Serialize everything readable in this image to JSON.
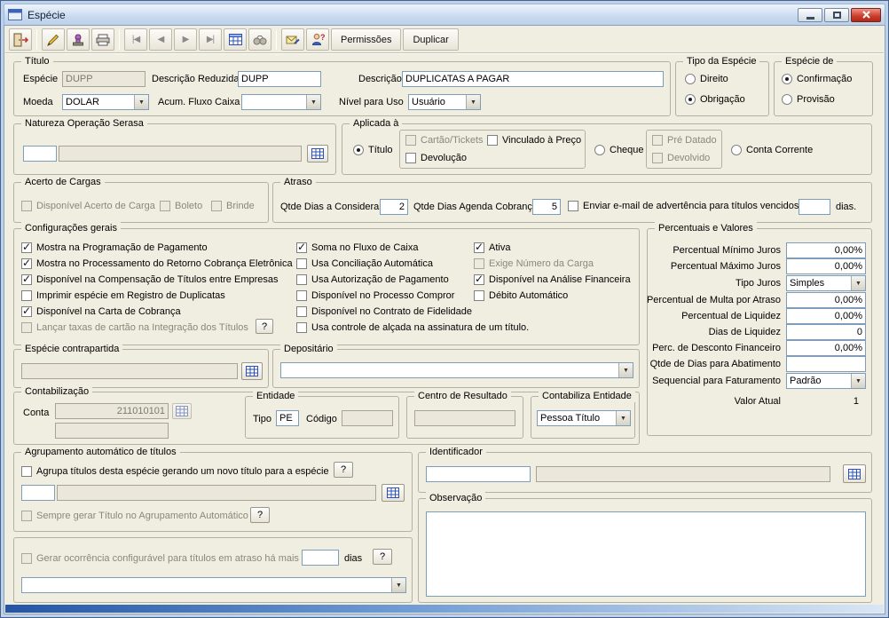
{
  "window": {
    "title": "Espécie"
  },
  "toolbar": {
    "nav_first": "|◀",
    "nav_prev": "◀",
    "nav_next": "▶",
    "nav_last": "▶|",
    "permissoes_label": "Permissões",
    "duplicar_label": "Duplicar"
  },
  "misc": {
    "help_label": "?"
  },
  "titulo": {
    "legend": "Título",
    "especie_label": "Espécie",
    "especie_value": "DUPP",
    "descricao_reduzida_label": "Descrição Reduzida",
    "descricao_reduzida_value": "DUPP",
    "descricao_label": "Descrição",
    "descricao_value": "DUPLICATAS A PAGAR",
    "moeda_label": "Moeda",
    "moeda_value": "DOLAR",
    "acum_fluxo_label": "Acum. Fluxo Caixa",
    "acum_fluxo_value": "",
    "nivel_label": "Nível para Uso",
    "nivel_value": "Usuário"
  },
  "tipo_especie": {
    "legend": "Tipo da Espécie",
    "options": [
      {
        "label": "Direito",
        "selected": false
      },
      {
        "label": "Obrigação",
        "selected": true
      }
    ]
  },
  "especie_de": {
    "legend": "Espécie de",
    "options": [
      {
        "label": "Confirmação",
        "selected": true
      },
      {
        "label": "Provisão",
        "selected": false
      }
    ]
  },
  "natureza": {
    "legend": "Natureza Operação Serasa",
    "code_value": "",
    "desc_value": ""
  },
  "aplicada": {
    "legend": "Aplicada à",
    "titulo": {
      "label": "Título",
      "selected": true
    },
    "cartao": {
      "label": "Cartão/Tickets",
      "checked": false,
      "disabled": true
    },
    "vinculado": {
      "label": "Vinculado à Preço",
      "checked": false,
      "disabled": false
    },
    "devolucao": {
      "label": "Devolução",
      "checked": false,
      "disabled": false
    },
    "cheque": {
      "label": "Cheque",
      "selected": false
    },
    "pre_datado": {
      "label": "Pré Datado",
      "checked": false,
      "disabled": true
    },
    "devolvido": {
      "label": "Devolvido",
      "checked": false,
      "disabled": true
    },
    "conta_corrente": {
      "label": "Conta Corrente",
      "selected": false
    }
  },
  "acerto": {
    "legend": "Acerto de Cargas",
    "items": [
      {
        "label": "Disponível Acerto de Carga",
        "checked": false,
        "disabled": true
      },
      {
        "label": "Boleto",
        "checked": false,
        "disabled": true
      },
      {
        "label": "Brinde",
        "checked": false,
        "disabled": true
      }
    ]
  },
  "atraso": {
    "legend": "Atraso",
    "qtde_considerar_label": "Qtde Dias a Considerar",
    "qtde_considerar_value": "2",
    "qtde_agenda_label": "Qtde Dias Agenda Cobrança",
    "qtde_agenda_value": "5",
    "email_checkbox": {
      "label": "Enviar e-mail de advertência para títulos vencidos à",
      "checked": false,
      "disabled": false
    },
    "email_dias_value": "",
    "dias_suffix": "dias."
  },
  "config": {
    "legend": "Configurações gerais",
    "col1": [
      {
        "label": "Mostra na Programação de Pagamento",
        "checked": true,
        "disabled": false
      },
      {
        "label": "Mostra no Processamento do Retorno Cobrança Eletrônica",
        "checked": true,
        "disabled": false
      },
      {
        "label": "Disponível na Compensação de Títulos entre Empresas",
        "checked": true,
        "disabled": false
      },
      {
        "label": "Imprimir espécie em Registro de Duplicatas",
        "checked": false,
        "disabled": false
      },
      {
        "label": "Disponível na Carta de Cobrança",
        "checked": true,
        "disabled": false
      },
      {
        "label": "Lançar taxas de cartão na Integração dos Títulos",
        "checked": false,
        "disabled": true
      }
    ],
    "col2": [
      {
        "label": "Soma no Fluxo de Caixa",
        "checked": true,
        "disabled": false
      },
      {
        "label": "Usa Conciliação Automática",
        "checked": false,
        "disabled": false
      },
      {
        "label": "Usa Autorização de Pagamento",
        "checked": false,
        "disabled": false
      },
      {
        "label": "Disponível no Processo Compror",
        "checked": false,
        "disabled": false
      },
      {
        "label": "Disponível no Contrato de Fidelidade",
        "checked": false,
        "disabled": false
      },
      {
        "label": "Usa controle de alçada na assinatura de um título.",
        "checked": false,
        "disabled": false
      }
    ],
    "col3": [
      {
        "label": "Ativa",
        "checked": true,
        "disabled": false
      },
      {
        "label": "Exige Número da Carga",
        "checked": false,
        "disabled": true
      },
      {
        "label": "Disponível na Análise Financeira",
        "checked": true,
        "disabled": false
      },
      {
        "label": "Débito Automático",
        "checked": false,
        "disabled": false
      }
    ]
  },
  "percentuais": {
    "legend": "Percentuais e Valores",
    "rows": [
      {
        "label": "Percentual Mínimo Juros",
        "value": "0,00%"
      },
      {
        "label": "Percentual Máximo Juros",
        "value": "0,00%"
      },
      {
        "label": "Tipo Juros",
        "value": "Simples"
      },
      {
        "label": "Percentual de Multa por Atraso",
        "value": "0,00%"
      },
      {
        "label": "Percentual de Liquidez",
        "value": "0,00%"
      },
      {
        "label": "Dias de Liquidez",
        "value": "0"
      },
      {
        "label": "Perc. de Desconto Financeiro",
        "value": "0,00%"
      },
      {
        "label": "Qtde de Dias para Abatimento",
        "value": ""
      },
      {
        "label": "Sequencial para Faturamento",
        "value": "Padrão"
      },
      {
        "label": "Valor Atual",
        "value": "1"
      }
    ]
  },
  "contrapartida": {
    "legend": "Espécie contrapartida",
    "value": ""
  },
  "depositario": {
    "legend": "Depositário",
    "value": ""
  },
  "contabilizacao": {
    "legend": "Contabilização",
    "conta_label": "Conta",
    "conta_value": "211010101",
    "conta2_value": "",
    "entidade": {
      "legend": "Entidade",
      "tipo_label": "Tipo",
      "tipo_value": "PE",
      "codigo_label": "Código",
      "codigo_value": ""
    },
    "centro": {
      "legend": "Centro de Resultado",
      "value": ""
    },
    "contabiliza": {
      "legend": "Contabiliza Entidade",
      "value": "Pessoa Título"
    }
  },
  "agrupamento": {
    "legend": "Agrupamento automático de títulos",
    "agrupa": {
      "label": "Agrupa títulos desta espécie gerando um novo título para a espécie",
      "checked": false,
      "disabled": false
    },
    "code_value": "",
    "desc_value": "",
    "sempre": {
      "label": "Sempre gerar Título no  Agrupamento Automático",
      "checked": false,
      "disabled": true
    }
  },
  "identificador": {
    "legend": "Identificador",
    "code_value": "",
    "desc_value": ""
  },
  "observacao": {
    "legend": "Observação",
    "value": ""
  },
  "ocorrencia": {
    "gerar": {
      "label": "Gerar ocorrência configurável para títulos em atraso há mais de",
      "checked": false,
      "disabled": true
    },
    "dias_value": "",
    "dias_suffix": "dias",
    "combo_value": ""
  }
}
